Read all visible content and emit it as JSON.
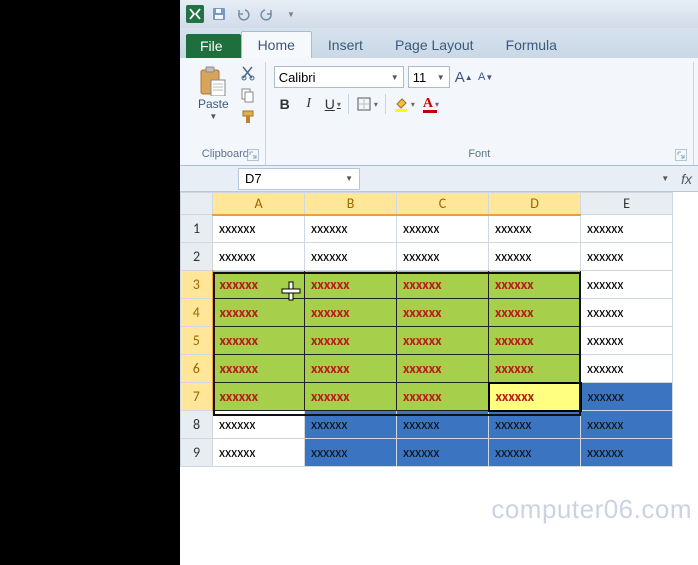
{
  "tabs": {
    "file": "File",
    "home": "Home",
    "insert": "Insert",
    "page_layout": "Page Layout",
    "formulas": "Formula"
  },
  "ribbon": {
    "clipboard": {
      "paste": "Paste",
      "label": "Clipboard"
    },
    "font": {
      "name": "Calibri",
      "size": "11",
      "bold": "B",
      "italic": "I",
      "underline": "U",
      "grow": "A",
      "shrink": "A",
      "label": "Font"
    }
  },
  "formula_bar": {
    "name_box": "D7",
    "fx": "fx"
  },
  "grid": {
    "col_headers": [
      "A",
      "B",
      "C",
      "D",
      "E"
    ],
    "row_headers": [
      "1",
      "2",
      "3",
      "4",
      "5",
      "6",
      "7",
      "8",
      "9"
    ],
    "cells": {
      "1": [
        "xxxxxx",
        "xxxxxx",
        "xxxxxx",
        "xxxxxx",
        "xxxxxx"
      ],
      "2": [
        "xxxxxx",
        "xxxxxx",
        "xxxxxx",
        "xxxxxx",
        "xxxxxx"
      ],
      "3": [
        "xxxxxx",
        "xxxxxx",
        "xxxxxx",
        "xxxxxx",
        "xxxxxx"
      ],
      "4": [
        "xxxxxx",
        "xxxxxx",
        "xxxxxx",
        "xxxxxx",
        "xxxxxx"
      ],
      "5": [
        "xxxxxx",
        "xxxxxx",
        "xxxxxx",
        "xxxxxx",
        "xxxxxx"
      ],
      "6": [
        "xxxxxx",
        "xxxxxx",
        "xxxxxx",
        "xxxxxx",
        "xxxxxx"
      ],
      "7": [
        "xxxxxx",
        "xxxxxx",
        "xxxxxx",
        "xxxxxx",
        "xxxxxx"
      ],
      "8": [
        "xxxxxx",
        "xxxxxx",
        "xxxxxx",
        "xxxxxx",
        "xxxxxx"
      ],
      "9": [
        "xxxxxx",
        "xxxxxx",
        "xxxxxx",
        "xxxxxx",
        "xxxxxx"
      ]
    },
    "selected_cols": [
      "A",
      "B",
      "C",
      "D"
    ],
    "selected_rows": [
      "3",
      "4",
      "5",
      "6",
      "7"
    ],
    "green_range": {
      "r1": 3,
      "r2": 7,
      "c1": 0,
      "c2": 3
    },
    "blue_range": {
      "r1": 7,
      "r2": 9,
      "c1": 1,
      "c2": 4
    },
    "active_cell": "D7"
  },
  "watermark": "computer06.com",
  "colors": {
    "green_fill": "#a6cf4b",
    "green_text": "#b02020",
    "blue_sel": "#3b74c0",
    "header_sel": "#ffe699",
    "file_tab": "#1e6f3e"
  }
}
